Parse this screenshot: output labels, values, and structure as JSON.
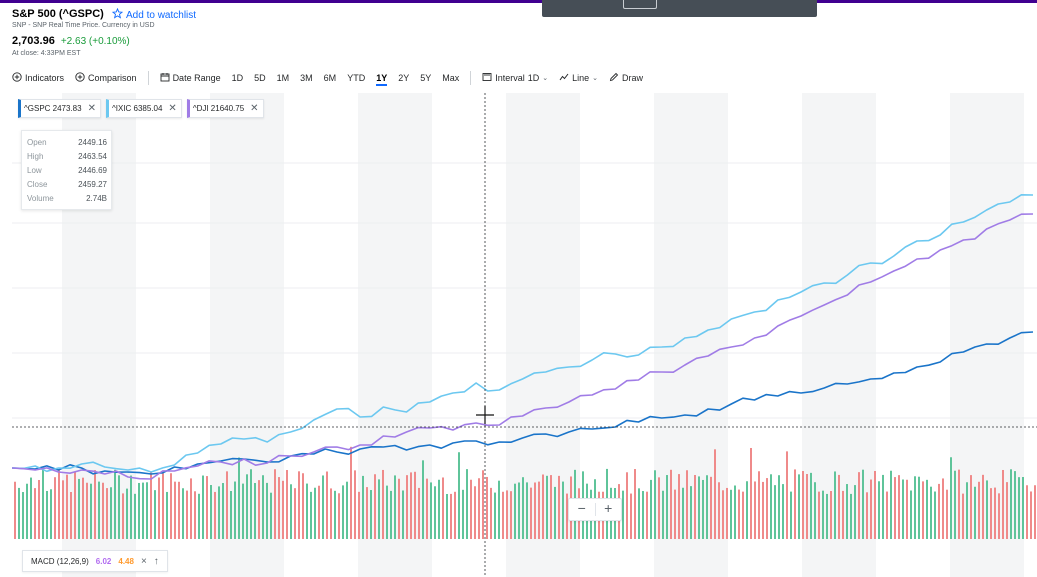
{
  "quote": {
    "title": "S&P 500 (^GSPC)",
    "watchlist_label": "Add to watchlist",
    "subtitle": "SNP - SNP Real Time Price. Currency in USD",
    "price": "2,703.96",
    "change": "+2.63 (+0.10%)",
    "close_note": "At close: 4:33PM EST"
  },
  "toolbar": {
    "indicators": "Indicators",
    "comparison": "Comparison",
    "date_range": "Date Range",
    "ranges": [
      "1D",
      "5D",
      "1M",
      "3M",
      "6M",
      "YTD",
      "1Y",
      "2Y",
      "5Y",
      "Max"
    ],
    "active_range": "1Y",
    "interval": "Interval",
    "interval_value": "1D",
    "line": "Line",
    "draw": "Draw"
  },
  "legend": [
    {
      "label": "^GSPC 2473.83",
      "color": "#1a74c9"
    },
    {
      "label": "^IXIC 6385.04",
      "color": "#6cc8f0"
    },
    {
      "label": "^DJI 21640.75",
      "color": "#a07ce6"
    }
  ],
  "tooltip": {
    "open_label": "Open",
    "open": "2449.16",
    "high_label": "High",
    "high": "2463.54",
    "low_label": "Low",
    "low": "2446.69",
    "close_label": "Close",
    "close": "2459.27",
    "volume_label": "Volume",
    "volume": "2.74B"
  },
  "zoom": {
    "minus": "−",
    "plus": "+"
  },
  "macd": {
    "label": "MACD (12,26,9)",
    "value1": "6.02",
    "value2": "4.48",
    "close": "×",
    "up": "↑"
  },
  "colors": {
    "accent": "#0f69ff",
    "positive": "#1a9c3b",
    "gspc": "#1a74c9",
    "ixic": "#6cc8f0",
    "dji": "#a07ce6",
    "volume_up": "#5fc49a",
    "volume_down": "#ef8a8a",
    "brand_bar": "#400090"
  },
  "chart_data": {
    "type": "line",
    "series": [
      {
        "name": "^GSPC",
        "values": [
          0,
          -0.1,
          -0.2,
          0,
          -0.3,
          -0.4,
          -0.6,
          0.1,
          0.4,
          0.7,
          0.9,
          0.6,
          1.2,
          1.4,
          1.6,
          1.9,
          2.1,
          1.8,
          2.3,
          2.5,
          2.7,
          2.6,
          3.0,
          3.4,
          3.6,
          3.9,
          4.1,
          4.6,
          5.0,
          5.3,
          5.9,
          6.4,
          6.8,
          7.2,
          7.5,
          8.0,
          8.4,
          8.9,
          9.5,
          10.1,
          10.6,
          11.6,
          12.4,
          13.0,
          13.6
        ]
      },
      {
        "name": "^IXIC",
        "values": [
          0,
          0.2,
          0,
          0.4,
          0.1,
          -0.2,
          -0.4,
          0.3,
          1.5,
          2.4,
          2.9,
          2.6,
          3.6,
          4.8,
          5.9,
          5.1,
          6.1,
          5.6,
          6.6,
          7.5,
          8.5,
          7.8,
          8.9,
          9.6,
          10.1,
          10.8,
          11.4,
          11.3,
          12.1,
          13.0,
          13.8,
          14.9,
          15.6,
          16.8,
          17.6,
          18.5,
          19.3,
          20.5,
          21.2,
          22.7,
          23.3,
          24.6,
          25.8,
          26.6,
          27.3
        ]
      },
      {
        "name": "^DJI",
        "values": [
          0,
          -0.2,
          -0.4,
          -0.2,
          -0.6,
          -0.9,
          -1.1,
          -0.3,
          0.2,
          0.6,
          0.9,
          0.5,
          1.2,
          1.6,
          2.1,
          2.3,
          3.2,
          3.6,
          4.0,
          3.8,
          4.5,
          4.3,
          5.2,
          6.0,
          6.6,
          7.3,
          7.9,
          8.8,
          9.6,
          10.3,
          11.2,
          12.1,
          13.0,
          14.2,
          15.2,
          16.3,
          17.3,
          18.6,
          19.7,
          20.9,
          21.8,
          22.8,
          23.9,
          24.8,
          25.4
        ]
      }
    ]
  }
}
